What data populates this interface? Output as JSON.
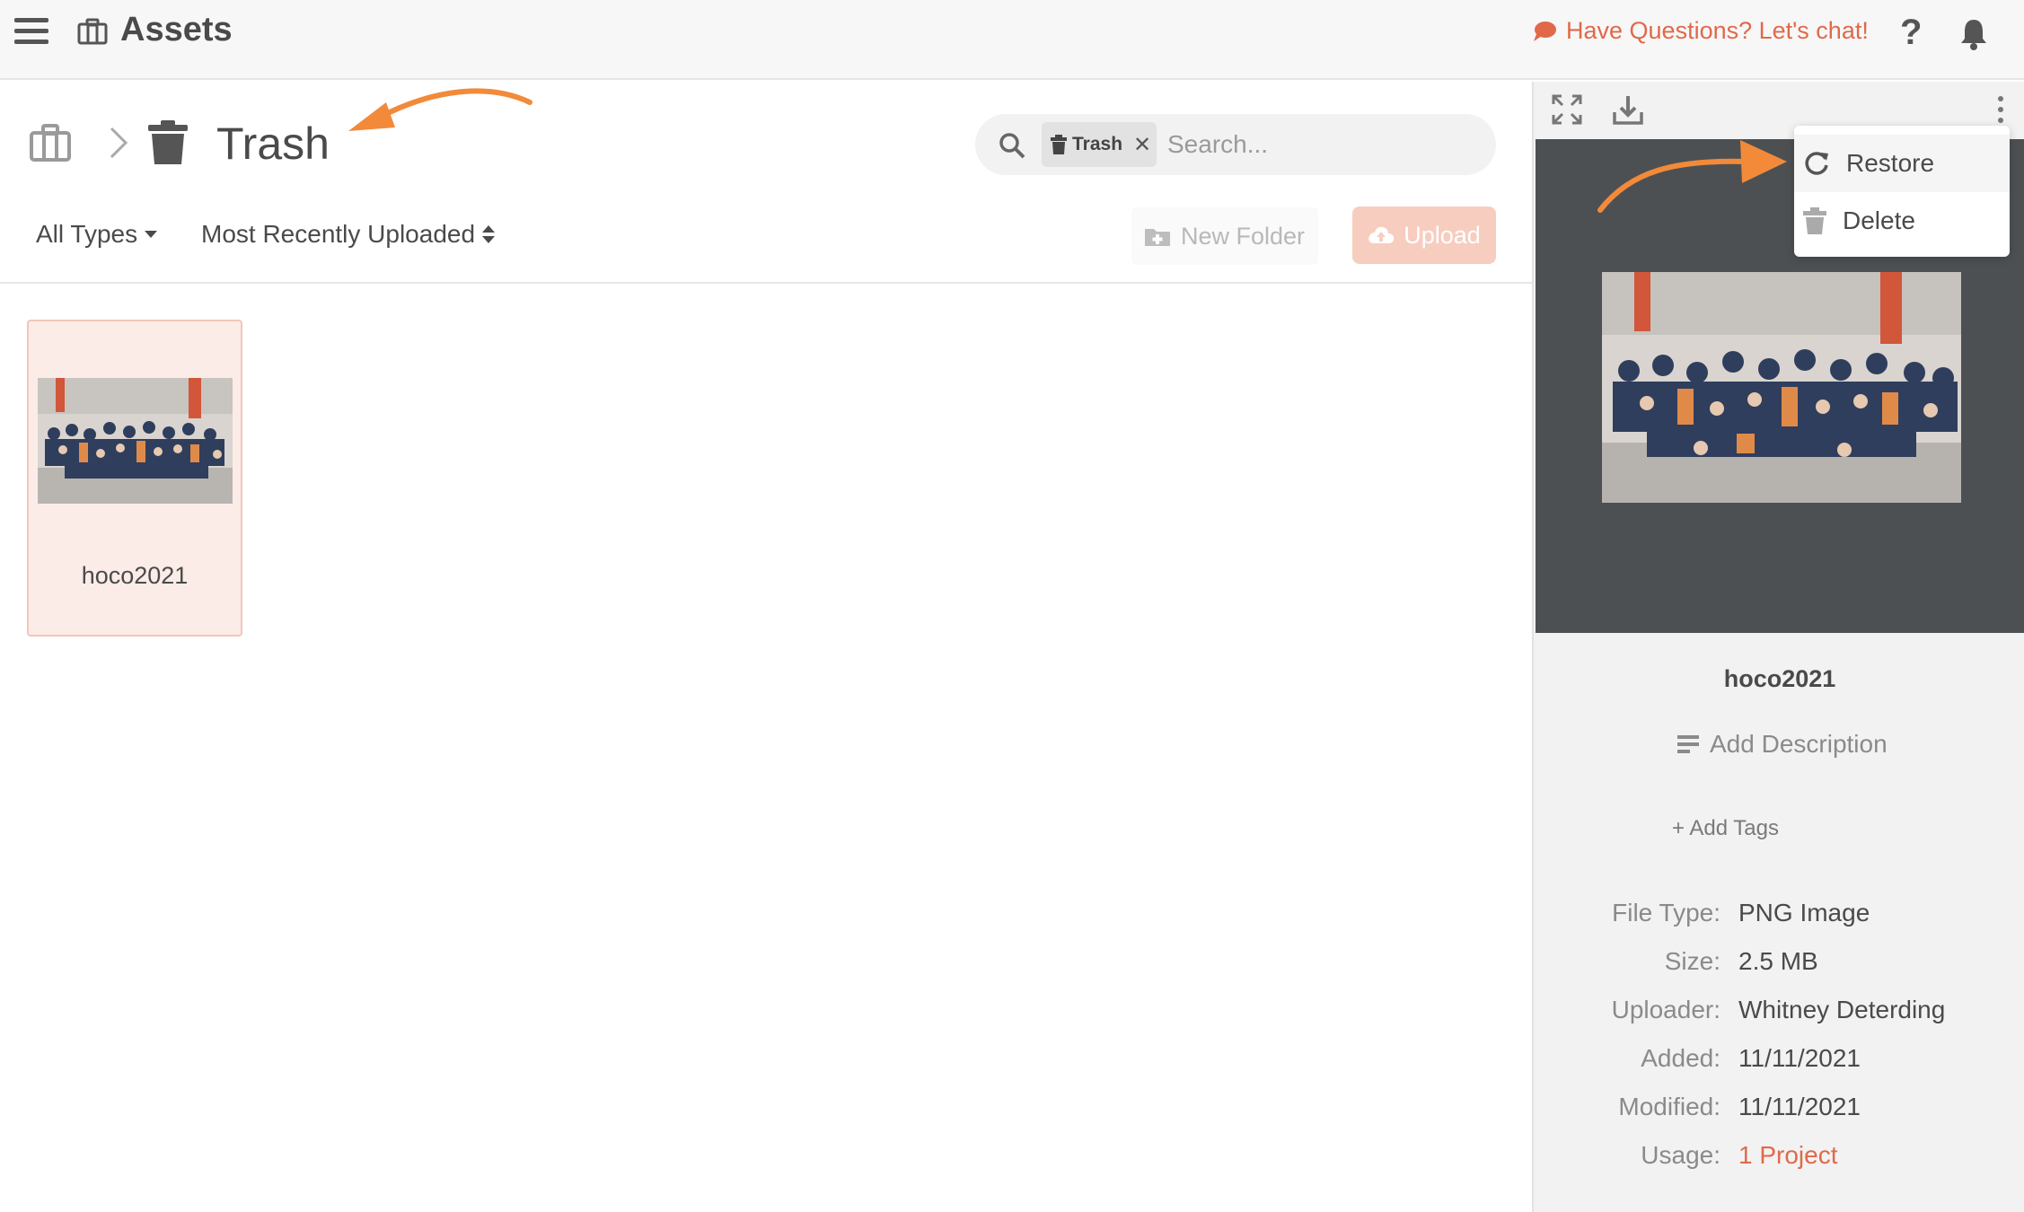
{
  "header": {
    "title": "Assets",
    "chat_label": "Have Questions? Let's chat!",
    "help_label": "?"
  },
  "breadcrumb": {
    "current": "Trash"
  },
  "search": {
    "chip_label": "Trash",
    "placeholder": "Search..."
  },
  "toolbar": {
    "type_filter": "All Types",
    "sort": "Most Recently Uploaded",
    "new_folder": "New Folder",
    "upload": "Upload"
  },
  "grid": {
    "items": [
      {
        "name": "hoco2021"
      }
    ]
  },
  "menu": {
    "restore": "Restore",
    "delete": "Delete"
  },
  "details": {
    "name": "hoco2021",
    "add_description": "Add Description",
    "add_tags": "+ Add Tags",
    "fields": [
      {
        "label": "File Type:",
        "value": "PNG Image"
      },
      {
        "label": "Size:",
        "value": "2.5 MB"
      },
      {
        "label": "Uploader:",
        "value": "Whitney Deterding"
      },
      {
        "label": "Added:",
        "value": "11/11/2021"
      },
      {
        "label": "Modified:",
        "value": "11/11/2021"
      },
      {
        "label": "Usage:",
        "value": "1 Project"
      }
    ]
  },
  "colors": {
    "accent": "#e0694a",
    "annotation_arrow": "#f28a3a",
    "upload_disabled": "#f7cdbf",
    "preview_bg": "#4d5052"
  },
  "icons": {
    "menu": "hamburger-icon",
    "brand": "briefcase-icon",
    "chat": "speech-bubble-icon",
    "bell": "bell-icon",
    "trash": "trash-icon",
    "search": "search-icon",
    "expand": "expand-icon",
    "download": "download-icon",
    "more": "kebab-icon",
    "restore": "refresh-icon"
  }
}
